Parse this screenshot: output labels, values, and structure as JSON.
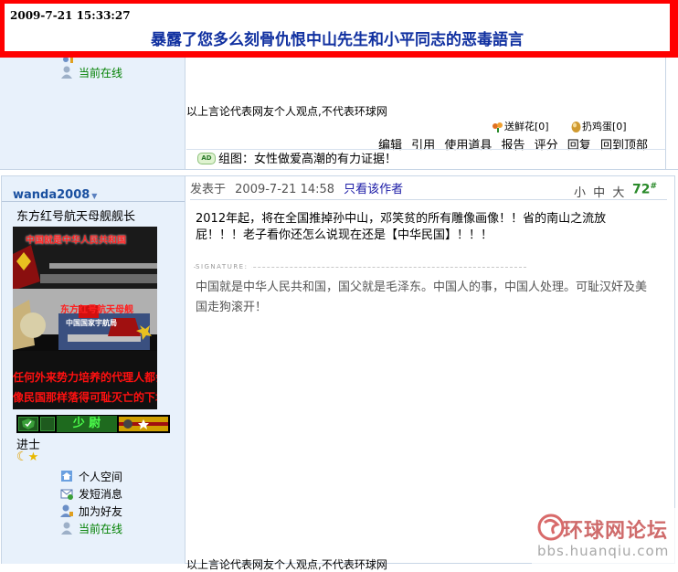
{
  "banner": {
    "timestamp": "2009-7-21 15:33:27",
    "title": "暴露了您多么刻骨仇恨中山先生和小平同志的恶毒語言"
  },
  "post1": {
    "online_status": "当前在线",
    "disclaimer": "以上言论代表网友个人观点,不代表环球网",
    "flowers": "送鲜花[0]",
    "eggs": "扔鸡蛋[0]",
    "actions": [
      "编辑",
      "引用",
      "使用道具",
      "报告",
      "评分",
      "回复",
      "回到顶部"
    ],
    "ad_badge": "AD",
    "ad_text": "组图：女性做爱高潮的有力证据！"
  },
  "post2": {
    "username": "wanda2008",
    "user_title": "东方红号航天母舰舰长",
    "avatar_lines": [
      "中国就是中华人民共和国",
      "东方红号航天母舰",
      "中国国家宇航局"
    ],
    "avatar_bottom": [
      "任何外来势力培养的代理人都会",
      "像民国那样落得可耻灭亡的下场"
    ],
    "rank_label": "少 尉",
    "rank": "进士",
    "links": [
      "个人空间",
      "发短消息",
      "加为好友",
      "当前在线"
    ],
    "posted_label": "发表于",
    "posted_time": "2009-7-21 14:58",
    "only_author": "只看该作者",
    "font_sizes": [
      "小",
      "中",
      "大"
    ],
    "floor": "72",
    "floor_sup": "#",
    "body": "2012年起，将在全国推掉孙中山，邓笑贫的所有雕像画像！！省的南山之流放屁！！！老子看你还怎么说现在还是【中华民国】！！！",
    "signature_label": "SIGNATURE:",
    "signature": "中国就是中华人民共和国，国父就是毛泽东。中国人的事，中国人处理。可耻汉奸及美国走狗滚开！",
    "disclaimer": "以上言论代表网友个人观点,不代表环球网"
  },
  "watermark": {
    "name": "环球网论坛",
    "url": "bbs.huanqiu.com"
  }
}
